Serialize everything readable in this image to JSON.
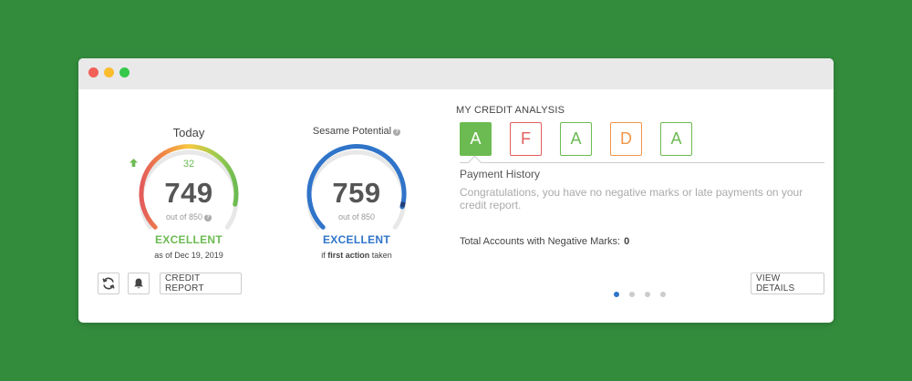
{
  "colors": {
    "background": "#338b3c",
    "excellent_green": "#6cbb52",
    "potential_blue": "#2f74c9",
    "grade_a": "#6cbb52",
    "grade_f": "#e25d5d",
    "grade_d": "#f0954a"
  },
  "today": {
    "title": "Today",
    "delta": "32",
    "delta_icon": "arrow-up-icon",
    "score": "749",
    "max": 850,
    "out_of": "out of 850",
    "rating": "EXCELLENT",
    "as_of": "as of Dec 19, 2019"
  },
  "potential": {
    "title": "Sesame Potential",
    "score": "759",
    "max": 850,
    "out_of": "out of 850",
    "rating": "EXCELLENT",
    "note_prefix": "if ",
    "note_strong": "first action",
    "note_suffix": " taken"
  },
  "actions": {
    "refresh_icon": "refresh-icon",
    "alert_icon": "bell-icon",
    "credit_report_label": "CREDIT REPORT"
  },
  "analysis": {
    "title": "MY CREDIT ANALYSIS",
    "grades": [
      {
        "letter": "A",
        "color": "#6cbb52",
        "selected": true
      },
      {
        "letter": "F",
        "color": "#e25d5d",
        "selected": false
      },
      {
        "letter": "A",
        "color": "#6cbb52",
        "selected": false
      },
      {
        "letter": "D",
        "color": "#f0954a",
        "selected": false
      },
      {
        "letter": "A",
        "color": "#6cbb52",
        "selected": false
      }
    ],
    "active_item": "Payment History",
    "description": "Congratulations, you have no negative marks or late payments on your credit report.",
    "negative_label": "Total Accounts with Negative Marks:",
    "negative_value": "0",
    "view_details_label": "VIEW DETAILS",
    "pages": 4,
    "active_page": 1
  }
}
